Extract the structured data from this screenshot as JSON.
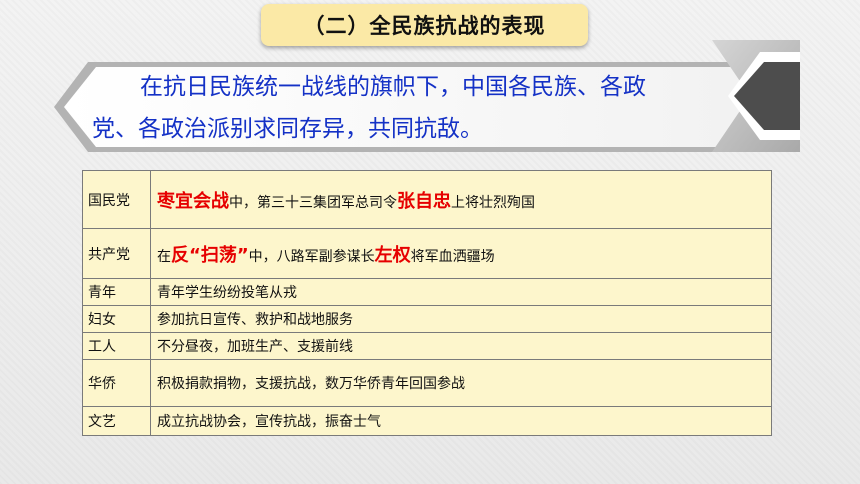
{
  "title": "（二）全民族抗战的表现",
  "intro": {
    "line1": "在抗日民族统一战线的旗帜下，中国各民族、各政",
    "line2": "党、各政治派别求同存异，共同抗敌。"
  },
  "table": {
    "rows": [
      {
        "category": "国民党",
        "parts": [
          {
            "text": "枣宜会战",
            "highlight": true
          },
          {
            "text": "中，第三十三集团军总司令",
            "highlight": false
          },
          {
            "text": "张自忠",
            "highlight": true
          },
          {
            "text": "上将壮烈殉国",
            "highlight": false
          }
        ]
      },
      {
        "category": "共产党",
        "parts": [
          {
            "text": "在",
            "highlight": false
          },
          {
            "text": "反“扫荡”",
            "highlight": true
          },
          {
            "text": "中，八路军副参谋长",
            "highlight": false
          },
          {
            "text": "左权",
            "highlight": true
          },
          {
            "text": "将军血洒疆场",
            "highlight": false
          }
        ]
      },
      {
        "category": "青年",
        "parts": [
          {
            "text": "青年学生纷纷投笔从戎",
            "highlight": false
          }
        ]
      },
      {
        "category": "妇女",
        "parts": [
          {
            "text": "参加抗日宣传、救护和战地服务",
            "highlight": false
          }
        ]
      },
      {
        "category": "工人",
        "parts": [
          {
            "text": "不分昼夜，加班生产、支援前线",
            "highlight": false
          }
        ]
      },
      {
        "category": "华侨",
        "parts": [
          {
            "text": "积极捐款捐物，支援抗战，数万华侨青年回国参战",
            "highlight": false
          }
        ]
      },
      {
        "category": "文艺",
        "parts": [
          {
            "text": "成立抗战协会，宣传抗战，振奋士气",
            "highlight": false
          }
        ]
      }
    ]
  },
  "colors": {
    "title_bg": "#fbe9a6",
    "intro_text": "#1431c6",
    "highlight": "#e60000",
    "table_bg": "#fdf6cc"
  },
  "icons": {
    "banner_arrow": "arrow-left-icon"
  }
}
